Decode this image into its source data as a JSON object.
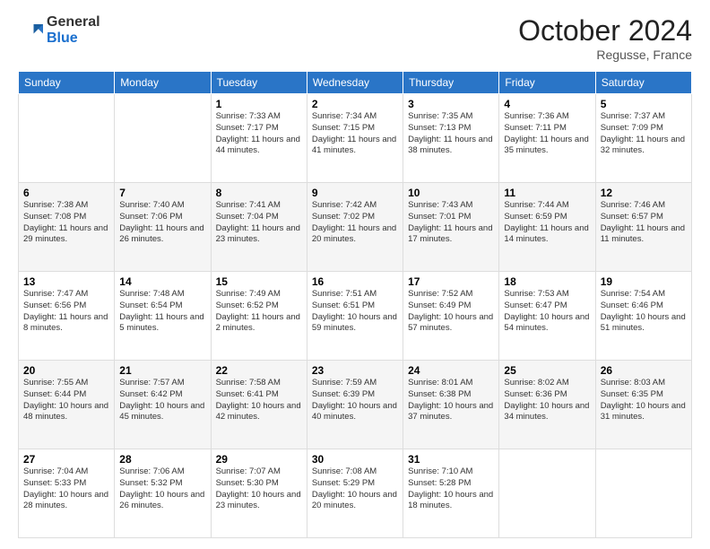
{
  "logo": {
    "general": "General",
    "blue": "Blue"
  },
  "header": {
    "month": "October 2024",
    "location": "Regusse, France"
  },
  "weekdays": [
    "Sunday",
    "Monday",
    "Tuesday",
    "Wednesday",
    "Thursday",
    "Friday",
    "Saturday"
  ],
  "weeks": [
    [
      {
        "day": "",
        "info": ""
      },
      {
        "day": "",
        "info": ""
      },
      {
        "day": "1",
        "info": "Sunrise: 7:33 AM\nSunset: 7:17 PM\nDaylight: 11 hours and 44 minutes."
      },
      {
        "day": "2",
        "info": "Sunrise: 7:34 AM\nSunset: 7:15 PM\nDaylight: 11 hours and 41 minutes."
      },
      {
        "day": "3",
        "info": "Sunrise: 7:35 AM\nSunset: 7:13 PM\nDaylight: 11 hours and 38 minutes."
      },
      {
        "day": "4",
        "info": "Sunrise: 7:36 AM\nSunset: 7:11 PM\nDaylight: 11 hours and 35 minutes."
      },
      {
        "day": "5",
        "info": "Sunrise: 7:37 AM\nSunset: 7:09 PM\nDaylight: 11 hours and 32 minutes."
      }
    ],
    [
      {
        "day": "6",
        "info": "Sunrise: 7:38 AM\nSunset: 7:08 PM\nDaylight: 11 hours and 29 minutes."
      },
      {
        "day": "7",
        "info": "Sunrise: 7:40 AM\nSunset: 7:06 PM\nDaylight: 11 hours and 26 minutes."
      },
      {
        "day": "8",
        "info": "Sunrise: 7:41 AM\nSunset: 7:04 PM\nDaylight: 11 hours and 23 minutes."
      },
      {
        "day": "9",
        "info": "Sunrise: 7:42 AM\nSunset: 7:02 PM\nDaylight: 11 hours and 20 minutes."
      },
      {
        "day": "10",
        "info": "Sunrise: 7:43 AM\nSunset: 7:01 PM\nDaylight: 11 hours and 17 minutes."
      },
      {
        "day": "11",
        "info": "Sunrise: 7:44 AM\nSunset: 6:59 PM\nDaylight: 11 hours and 14 minutes."
      },
      {
        "day": "12",
        "info": "Sunrise: 7:46 AM\nSunset: 6:57 PM\nDaylight: 11 hours and 11 minutes."
      }
    ],
    [
      {
        "day": "13",
        "info": "Sunrise: 7:47 AM\nSunset: 6:56 PM\nDaylight: 11 hours and 8 minutes."
      },
      {
        "day": "14",
        "info": "Sunrise: 7:48 AM\nSunset: 6:54 PM\nDaylight: 11 hours and 5 minutes."
      },
      {
        "day": "15",
        "info": "Sunrise: 7:49 AM\nSunset: 6:52 PM\nDaylight: 11 hours and 2 minutes."
      },
      {
        "day": "16",
        "info": "Sunrise: 7:51 AM\nSunset: 6:51 PM\nDaylight: 10 hours and 59 minutes."
      },
      {
        "day": "17",
        "info": "Sunrise: 7:52 AM\nSunset: 6:49 PM\nDaylight: 10 hours and 57 minutes."
      },
      {
        "day": "18",
        "info": "Sunrise: 7:53 AM\nSunset: 6:47 PM\nDaylight: 10 hours and 54 minutes."
      },
      {
        "day": "19",
        "info": "Sunrise: 7:54 AM\nSunset: 6:46 PM\nDaylight: 10 hours and 51 minutes."
      }
    ],
    [
      {
        "day": "20",
        "info": "Sunrise: 7:55 AM\nSunset: 6:44 PM\nDaylight: 10 hours and 48 minutes."
      },
      {
        "day": "21",
        "info": "Sunrise: 7:57 AM\nSunset: 6:42 PM\nDaylight: 10 hours and 45 minutes."
      },
      {
        "day": "22",
        "info": "Sunrise: 7:58 AM\nSunset: 6:41 PM\nDaylight: 10 hours and 42 minutes."
      },
      {
        "day": "23",
        "info": "Sunrise: 7:59 AM\nSunset: 6:39 PM\nDaylight: 10 hours and 40 minutes."
      },
      {
        "day": "24",
        "info": "Sunrise: 8:01 AM\nSunset: 6:38 PM\nDaylight: 10 hours and 37 minutes."
      },
      {
        "day": "25",
        "info": "Sunrise: 8:02 AM\nSunset: 6:36 PM\nDaylight: 10 hours and 34 minutes."
      },
      {
        "day": "26",
        "info": "Sunrise: 8:03 AM\nSunset: 6:35 PM\nDaylight: 10 hours and 31 minutes."
      }
    ],
    [
      {
        "day": "27",
        "info": "Sunrise: 7:04 AM\nSunset: 5:33 PM\nDaylight: 10 hours and 28 minutes."
      },
      {
        "day": "28",
        "info": "Sunrise: 7:06 AM\nSunset: 5:32 PM\nDaylight: 10 hours and 26 minutes."
      },
      {
        "day": "29",
        "info": "Sunrise: 7:07 AM\nSunset: 5:30 PM\nDaylight: 10 hours and 23 minutes."
      },
      {
        "day": "30",
        "info": "Sunrise: 7:08 AM\nSunset: 5:29 PM\nDaylight: 10 hours and 20 minutes."
      },
      {
        "day": "31",
        "info": "Sunrise: 7:10 AM\nSunset: 5:28 PM\nDaylight: 10 hours and 18 minutes."
      },
      {
        "day": "",
        "info": ""
      },
      {
        "day": "",
        "info": ""
      }
    ]
  ]
}
